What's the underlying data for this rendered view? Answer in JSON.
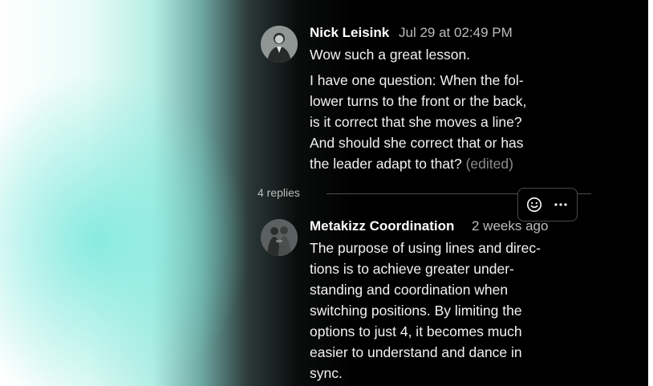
{
  "comment": {
    "author": "Nick Leisink",
    "timestamp": "Jul 29 at 02:49 PM",
    "lines_p1": [
      "Wow such a great lesson."
    ],
    "lines_p2": [
      "I have one question: When the fol-",
      "lower turns to the front or the back,",
      "is it correct that she moves a line?",
      "And should she correct that or has",
      "the leader adapt to that?"
    ],
    "edited_label": "(edited)",
    "avatar_icon": "person-avatar"
  },
  "replies": {
    "count_label": "4 replies"
  },
  "actions": {
    "react_icon": "smiley-icon",
    "more_icon": "more-horizontal-icon"
  },
  "reply": {
    "author": "Metakizz Coordination",
    "timestamp": "2 weeks ago",
    "lines": [
      "The purpose of using lines and direc-",
      "tions is to achieve greater under-",
      "standing and coordination when",
      "switching positions. By limiting the",
      "options to just 4, it becomes much",
      "easier to understand and dance in",
      "sync."
    ],
    "avatar_icon": "couple-avatar"
  }
}
